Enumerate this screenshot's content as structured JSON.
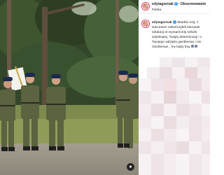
{
  "post": {
    "author": "edytagornak",
    "follow_label": "Obserwowanie",
    "location": "Polska",
    "caption_author": "edytagornak",
    "caption_text": "Skarbie mój, z sukcesem zakończyłeś kierunek edukacji w wymarzonej szkole wojskowej. Twojej determinacji i z Twojego wdzięku gentleman i nie Gentleman , my baby boy"
  },
  "icons": {
    "verified": "verified-badge-icon",
    "corner": "tag-people-icon"
  },
  "colors": {
    "accent": "#3897f0",
    "ring": "#e1306c",
    "uniform": "#5b6340",
    "forest": "#2f3d22"
  }
}
